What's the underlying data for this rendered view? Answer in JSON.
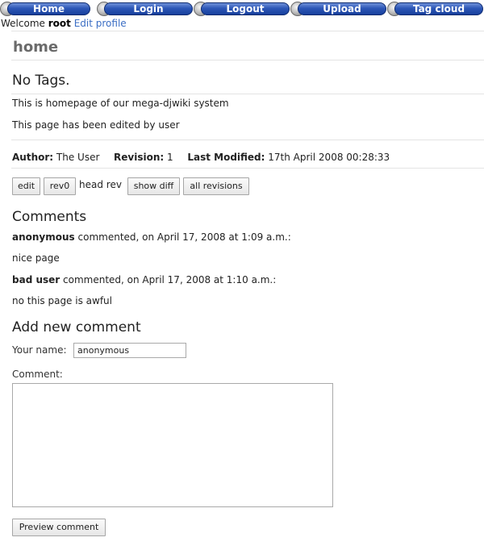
{
  "nav": {
    "items": [
      {
        "label": "Home"
      },
      {
        "label": "Login"
      },
      {
        "label": "Logout"
      },
      {
        "label": "Upload"
      },
      {
        "label": "Tag cloud"
      }
    ]
  },
  "welcome": {
    "prefix": "Welcome",
    "user": "root",
    "edit_profile": "Edit profile"
  },
  "page": {
    "title": "home",
    "tags": "No Tags.",
    "line1": "This is homepage of our mega-djwiki system",
    "line2": "This page has been edited by user"
  },
  "meta": {
    "author_label": "Author:",
    "author": "The User",
    "revision_label": "Revision:",
    "revision": "1",
    "modified_label": "Last Modified:",
    "modified": "17th April 2008 00:28:33"
  },
  "actions": {
    "edit": "edit",
    "rev0": "rev0",
    "head_rev": "head rev",
    "show_diff": "show diff",
    "all_revisions": "all revisions"
  },
  "comments": {
    "heading": "Comments",
    "items": [
      {
        "author": "anonymous",
        "meta": "commented, on April 17, 2008 at 1:09 a.m.:",
        "text": "nice page"
      },
      {
        "author": "bad user",
        "meta": "commented, on April 17, 2008 at 1:10 a.m.:",
        "text": "no this page is awful"
      }
    ]
  },
  "form": {
    "heading": "Add new comment",
    "name_label": "Your name:",
    "name_value": "anonymous",
    "comment_label": "Comment:",
    "comment_value": "",
    "preview_button": "Preview comment"
  }
}
